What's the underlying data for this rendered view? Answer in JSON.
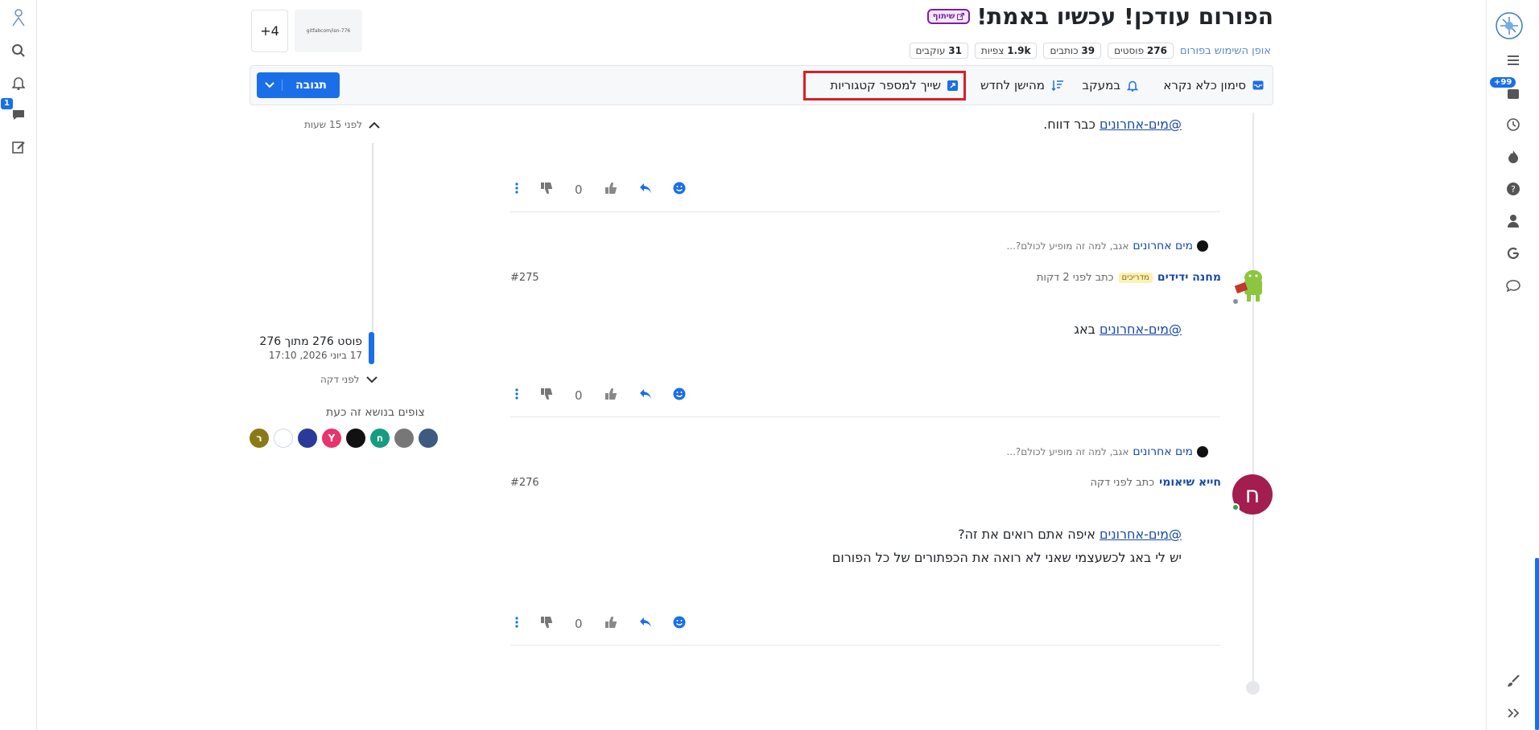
{
  "topic": {
    "title": "הפורום עודכן! עכשיו באמת!",
    "share_badge": "שיתוף",
    "usage_link": "אופן השימוש בפורום",
    "stats": [
      {
        "value": "276",
        "label": "פוסטים"
      },
      {
        "value": "39",
        "label": "כותבים"
      },
      {
        "value": "1.9k",
        "label": "צפיות"
      },
      {
        "value": "31",
        "label": "עוקבים"
      }
    ],
    "thumb_text": "gitfabcom/isn-776",
    "more_count": "+4"
  },
  "toolbar": {
    "mark_unread": "סימון כלא נקרא",
    "tracking": "במעקב",
    "sort": "מהישן לחדש",
    "assign_categories": "שייך למספר קטגוריות",
    "reply_button": "תגובה"
  },
  "left_rail": {
    "chat_badge": "1"
  },
  "right_rail": {
    "notifications_badge": "+99"
  },
  "posts": [
    {
      "mention": "@מים-אחרונים",
      "text": " כבר דווח.",
      "votes": "0"
    },
    {
      "reply_to_name": "מים אחרונים",
      "reply_to_snippet": "אגב, למה זה מופיע לכולם?...",
      "author": "מחנה ידידים",
      "badge": "מדריכים",
      "time": "כתב לפני 2 דקות",
      "number": "#275",
      "mention": "@מים-אחרונים",
      "text": " באג",
      "votes": "0"
    },
    {
      "reply_to_name": "מים אחרונים",
      "reply_to_snippet": "אגב, למה זה מופיע לכולם?...",
      "author": "חייא שיאומי",
      "avatar_letter": "ח",
      "time": "כתב לפני דקה",
      "number": "#276",
      "mention": "@מים-אחרונים",
      "text": " איפה אתם רואים את זה?",
      "text2": "יש לי באג לכשעצמי שאני לא רואה את הכפתורים של כל הפורום",
      "votes": "0"
    }
  ],
  "scrubber": {
    "top_time": "לפני 15 שעות",
    "position": "פוסט 276 מתוך 276",
    "date": "17 ביוני 2026, 17:10",
    "bottom_time": "לפני דקה",
    "viewers_label": "צופים בנושא זה כעת"
  },
  "viewers": [
    {
      "letter": "ר",
      "color": "#8a7a16"
    },
    {
      "letter": "",
      "color": "#ffffff"
    },
    {
      "letter": "",
      "color": "#2a3a9a"
    },
    {
      "letter": "Y",
      "color": "#e8336d"
    },
    {
      "letter": "",
      "color": "#111111"
    },
    {
      "letter": "ח",
      "color": "#169c80"
    },
    {
      "letter": "",
      "color": "#777777"
    },
    {
      "letter": "",
      "color": "#3d5a80"
    }
  ],
  "colors": {
    "accent": "#1a6fe8",
    "highlight": "#d91f26",
    "avatar_het": "#a31d4f"
  }
}
